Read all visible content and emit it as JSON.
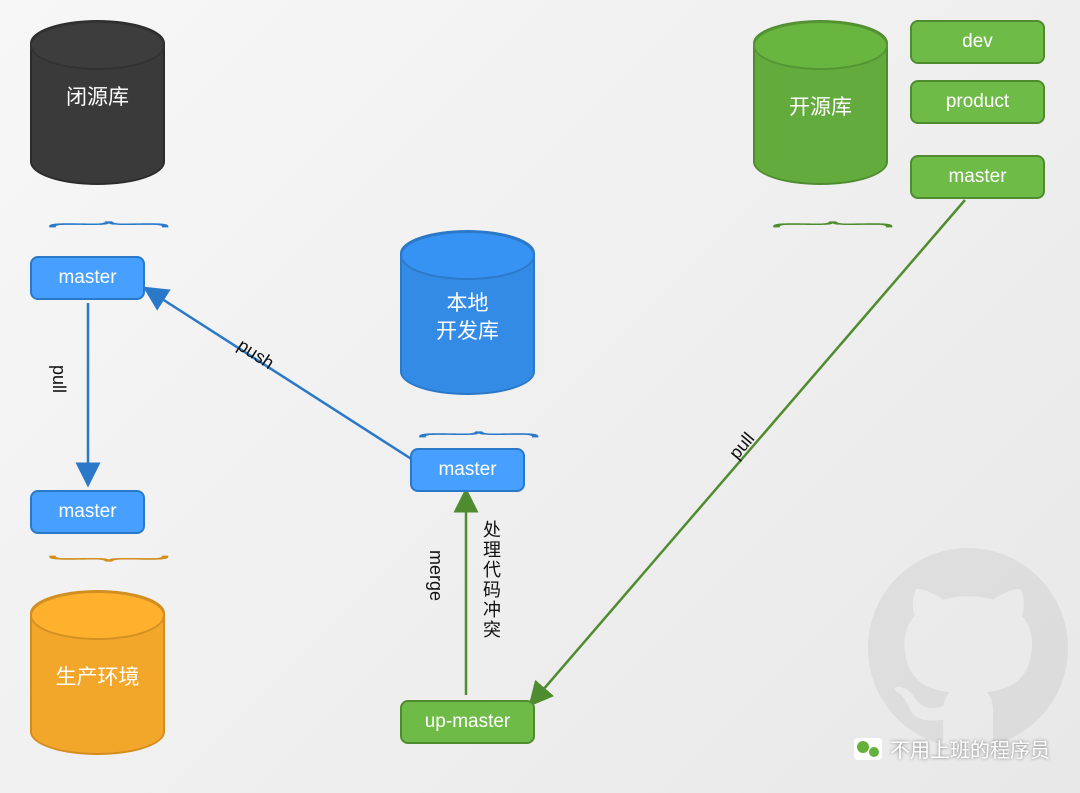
{
  "repos": {
    "closed": {
      "label": "闭源库",
      "color": "dark"
    },
    "local": {
      "label": "本地\n开发库",
      "color": "blue"
    },
    "production": {
      "label": "生产环境",
      "color": "orange"
    },
    "open": {
      "label": "开源库",
      "color": "green"
    }
  },
  "branches": {
    "closed_master": {
      "label": "master",
      "color": "blue"
    },
    "prod_master": {
      "label": "master",
      "color": "blue"
    },
    "local_master": {
      "label": "master",
      "color": "blue"
    },
    "up_master": {
      "label": "up-master",
      "color": "green"
    },
    "open_dev": {
      "label": "dev",
      "color": "green"
    },
    "open_product": {
      "label": "product",
      "color": "green"
    },
    "open_master": {
      "label": "master",
      "color": "green"
    }
  },
  "edges": {
    "pull_closed_to_prod": {
      "label": "pull"
    },
    "push_local_to_closed": {
      "label": "push"
    },
    "merge_up_to_local": {
      "label": "merge",
      "note": "处理代码冲突"
    },
    "pull_open_to_up": {
      "label": "pull"
    }
  },
  "caption": "不用上班的程序员",
  "colors": {
    "blue": "#2a78c8",
    "green": "#4f8c2f",
    "orange": "#d38d1d"
  }
}
